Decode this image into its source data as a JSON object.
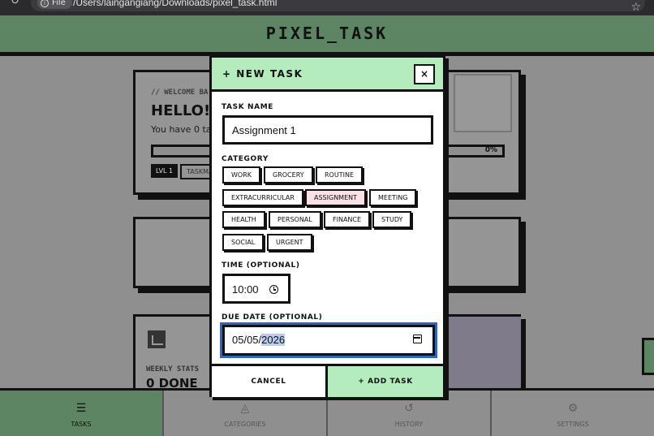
{
  "browser": {
    "reload_icon": "reload-icon",
    "file_chip": "File",
    "url": "/Users/laingangiang/Downloads/pixel_task.html",
    "star_icon": "star-icon"
  },
  "app": {
    "title": "PIXEL_TASK"
  },
  "background": {
    "welcome": {
      "kicker": "// WELCOME BA",
      "hello": "HELLO!",
      "tasks_text": "You have 0 tas",
      "progress_text": "0%",
      "progress_value": 0,
      "level": "LVL 1",
      "rank": "TASKMA"
    },
    "stats": {
      "label": "WEEKLY STATS",
      "value": "0 DONE"
    }
  },
  "modal": {
    "title": "+ NEW TASK",
    "close_label": "×",
    "task_name_label": "TASK NAME",
    "task_name_value": "Assignment 1",
    "category_label": "CATEGORY",
    "categories": [
      {
        "label": "WORK",
        "selected": false
      },
      {
        "label": "GROCERY",
        "selected": false
      },
      {
        "label": "ROUTINE",
        "selected": false
      },
      {
        "label": "EXTRACURRICULAR",
        "selected": false
      },
      {
        "label": "ASSIGNMENT",
        "selected": true
      },
      {
        "label": "MEETING",
        "selected": false
      },
      {
        "label": "HEALTH",
        "selected": false
      },
      {
        "label": "PERSONAL",
        "selected": false
      },
      {
        "label": "FINANCE",
        "selected": false
      },
      {
        "label": "STUDY",
        "selected": false
      },
      {
        "label": "SOCIAL",
        "selected": false
      },
      {
        "label": "URGENT",
        "selected": false
      }
    ],
    "time_label": "TIME (OPTIONAL)",
    "time_value": "10:00",
    "due_label": "DUE DATE (OPTIONAL)",
    "due_prefix": "05/05/",
    "due_year": "2026",
    "cancel_label": "CANCEL",
    "add_label": "+ ADD TASK"
  },
  "nav": {
    "items": [
      {
        "label": "TASKS",
        "icon": "list-icon",
        "active": true
      },
      {
        "label": "CATEGORIES",
        "icon": "shapes-icon",
        "active": false
      },
      {
        "label": "HISTORY",
        "icon": "history-icon",
        "active": false
      },
      {
        "label": "SETTINGS",
        "icon": "gear-icon",
        "active": false
      }
    ]
  },
  "colors": {
    "accent_green": "#b4ecbd",
    "selected_pink": "#fbe1e5",
    "focus_blue": "#2d64c9",
    "border": "#111111"
  }
}
